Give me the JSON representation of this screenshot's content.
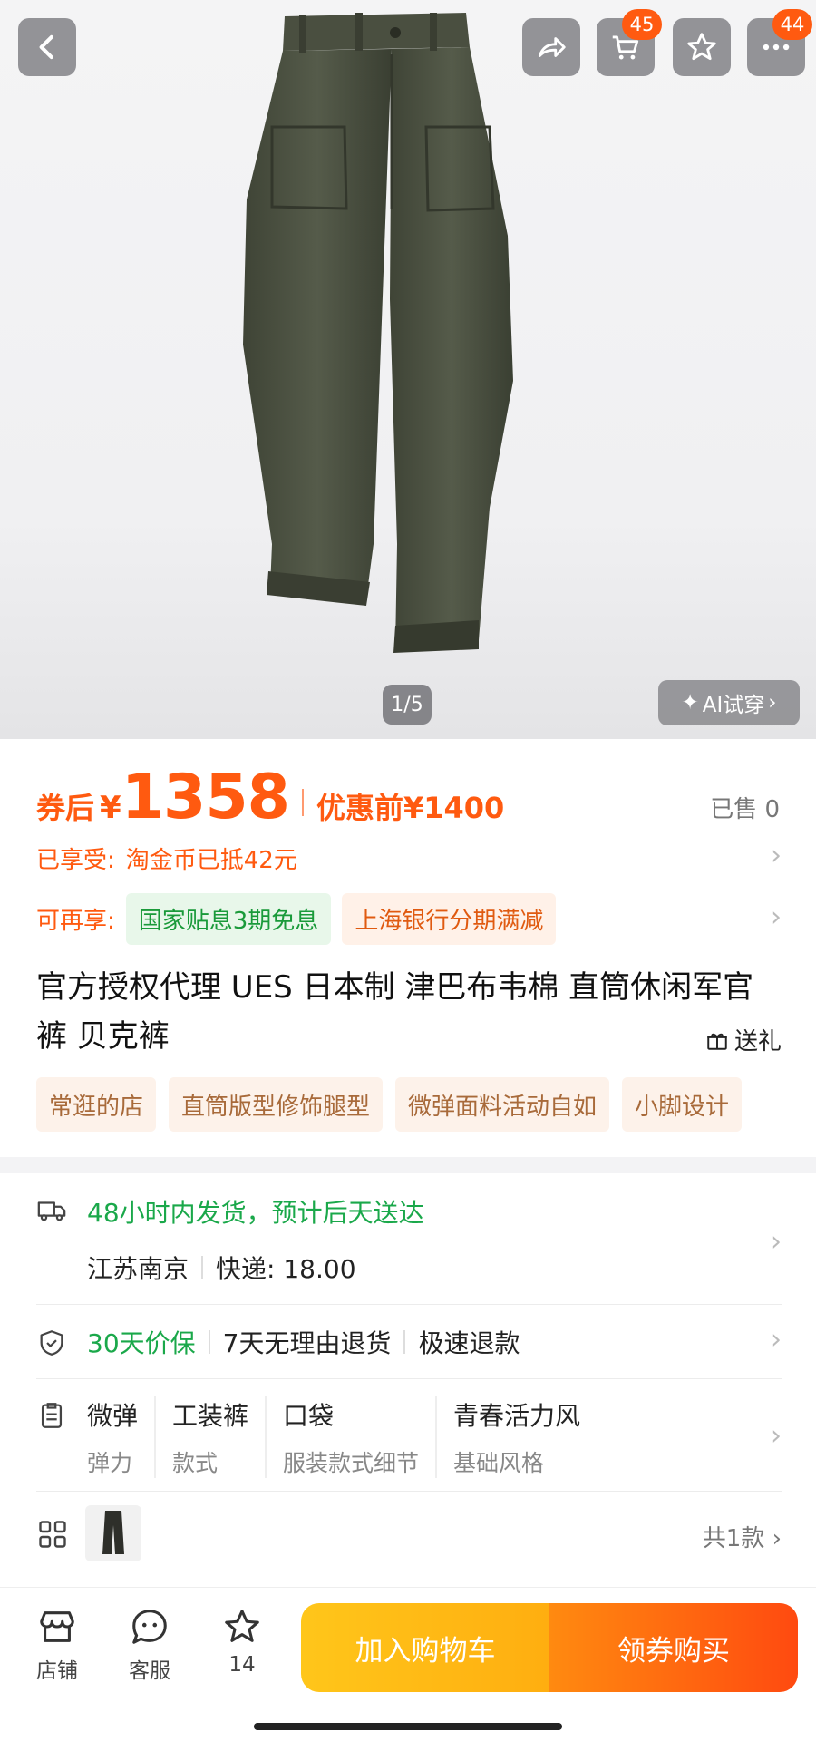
{
  "topbar": {
    "cart_badge": "45",
    "more_badge": "44"
  },
  "gallery": {
    "counter": "1/5",
    "ai_try_label": "AI试穿"
  },
  "price": {
    "coupon_label": "券后",
    "currency": "¥",
    "final_price": "1358",
    "pre_price": "优惠前¥1400",
    "sold": "已售 0"
  },
  "discounts": {
    "enjoyed_label": "已享受:",
    "enjoyed_value": "淘金币已抵42元",
    "more_label": "可再享:",
    "chip_green": "国家贴息3期免息",
    "chip_orange": "上海银行分期满减"
  },
  "product": {
    "title": "官方授权代理 UES 日本制 津巴布韦棉  直筒休闲军官裤 贝克裤",
    "gift_label": "送礼",
    "tags": [
      "常逛的店",
      "直筒版型修饰腿型",
      "微弹面料活动自如",
      "小脚设计"
    ]
  },
  "shipping": {
    "line1": "48小时内发货，预计后天送达",
    "origin": "江苏南京",
    "fee": "快递: 18.00"
  },
  "guarantee": {
    "price_protect": "30天价保",
    "return": "7天无理由退货",
    "refund": "极速退款"
  },
  "attributes": [
    {
      "value": "微弹",
      "key": "弹力"
    },
    {
      "value": "工装裤",
      "key": "款式"
    },
    {
      "value": "口袋",
      "key": "服装款式细节"
    },
    {
      "value": "青春活力风",
      "key": "基础风格"
    }
  ],
  "variants": {
    "count_label": "共1款"
  },
  "bottom_bar": {
    "shop_label": "店铺",
    "service_label": "客服",
    "fav_count": "14",
    "add_cart_label": "加入购物车",
    "buy_label": "领券购买"
  }
}
